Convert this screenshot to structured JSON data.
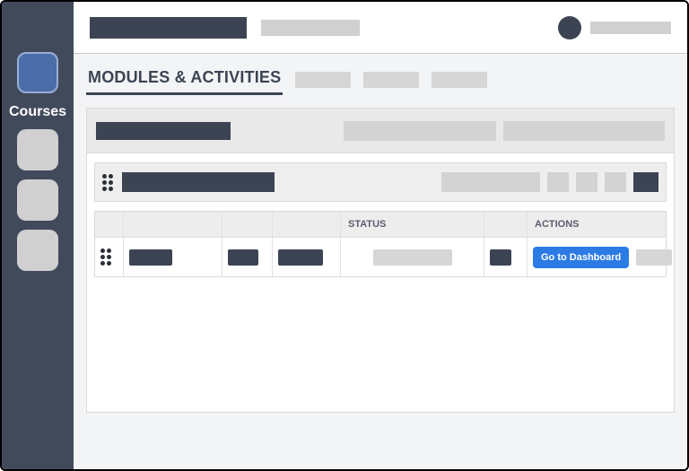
{
  "sidebar": {
    "active_label": "Courses"
  },
  "tabs": {
    "active": "MODULES & ACTIVITIES"
  },
  "grid": {
    "head": {
      "status": "STATUS",
      "actions": "ACTIONS"
    },
    "row0": {
      "action_btn": "Go to Dashboard"
    }
  }
}
